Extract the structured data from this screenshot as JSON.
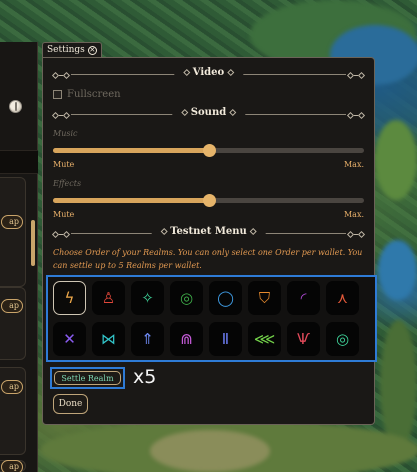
{
  "settings_tab": {
    "label": "Settings",
    "close_icon": "close-icon"
  },
  "sections": {
    "video": "Video",
    "sound": "Sound",
    "testnet": "Testnet Menu"
  },
  "video": {
    "fullscreen_label": "Fullscreen",
    "fullscreen_checked": false
  },
  "sound": {
    "music": {
      "label": "Music",
      "min": "Mute",
      "max": "Max.",
      "value": 0.5
    },
    "effects": {
      "label": "Effects",
      "min": "Mute",
      "max": "Max.",
      "value": 0.5
    }
  },
  "testnet": {
    "instructions": "Choose Order of your Realms. You can only select one Order per wallet. You can settle up to 5 Realms per wallet.",
    "orders": [
      {
        "icon": "lightning-icon",
        "glyph": "ϟ",
        "color": "#f0a94a",
        "selected": true
      },
      {
        "icon": "flame-icon",
        "glyph": "♙",
        "color": "#e0473a",
        "selected": false
      },
      {
        "icon": "sparkle-icon",
        "glyph": "✧",
        "color": "#3fd39a",
        "selected": false
      },
      {
        "icon": "swirl-icon",
        "glyph": "◎",
        "color": "#3fae4a",
        "selected": false
      },
      {
        "icon": "ring-icon",
        "glyph": "◯",
        "color": "#3f9be3",
        "selected": false
      },
      {
        "icon": "fox-icon",
        "glyph": "⛉",
        "color": "#e68a2e",
        "selected": false
      },
      {
        "icon": "crescent-icon",
        "glyph": "◜",
        "color": "#b24ad8",
        "selected": false
      },
      {
        "icon": "figure-icon",
        "glyph": "⋏",
        "color": "#e65a3a",
        "selected": false
      },
      {
        "icon": "star-knot-icon",
        "glyph": "✕",
        "color": "#8a5cf0",
        "selected": false
      },
      {
        "icon": "bowtie-icon",
        "glyph": "⋈",
        "color": "#32c4c9",
        "selected": false
      },
      {
        "icon": "arrow-up-icon",
        "glyph": "⇑",
        "color": "#6f8bf5",
        "selected": false
      },
      {
        "icon": "arch-icon",
        "glyph": "⋒",
        "color": "#c35ad6",
        "selected": false
      },
      {
        "icon": "pillars-icon",
        "glyph": "Ⅱ",
        "color": "#6d7cf2",
        "selected": false
      },
      {
        "icon": "leaf-icon",
        "glyph": "⋘",
        "color": "#73d24a",
        "selected": false
      },
      {
        "icon": "trident-icon",
        "glyph": "Ѱ",
        "color": "#e24a5a",
        "selected": false
      },
      {
        "icon": "spiral-icon",
        "glyph": "◎",
        "color": "#3fd39a",
        "selected": false
      }
    ],
    "settle_label": "Settle Realm",
    "multiplier": "x5"
  },
  "done_label": "Done",
  "left_panel": {
    "pill_label": "ap",
    "globe_icon": "globe-icon"
  }
}
